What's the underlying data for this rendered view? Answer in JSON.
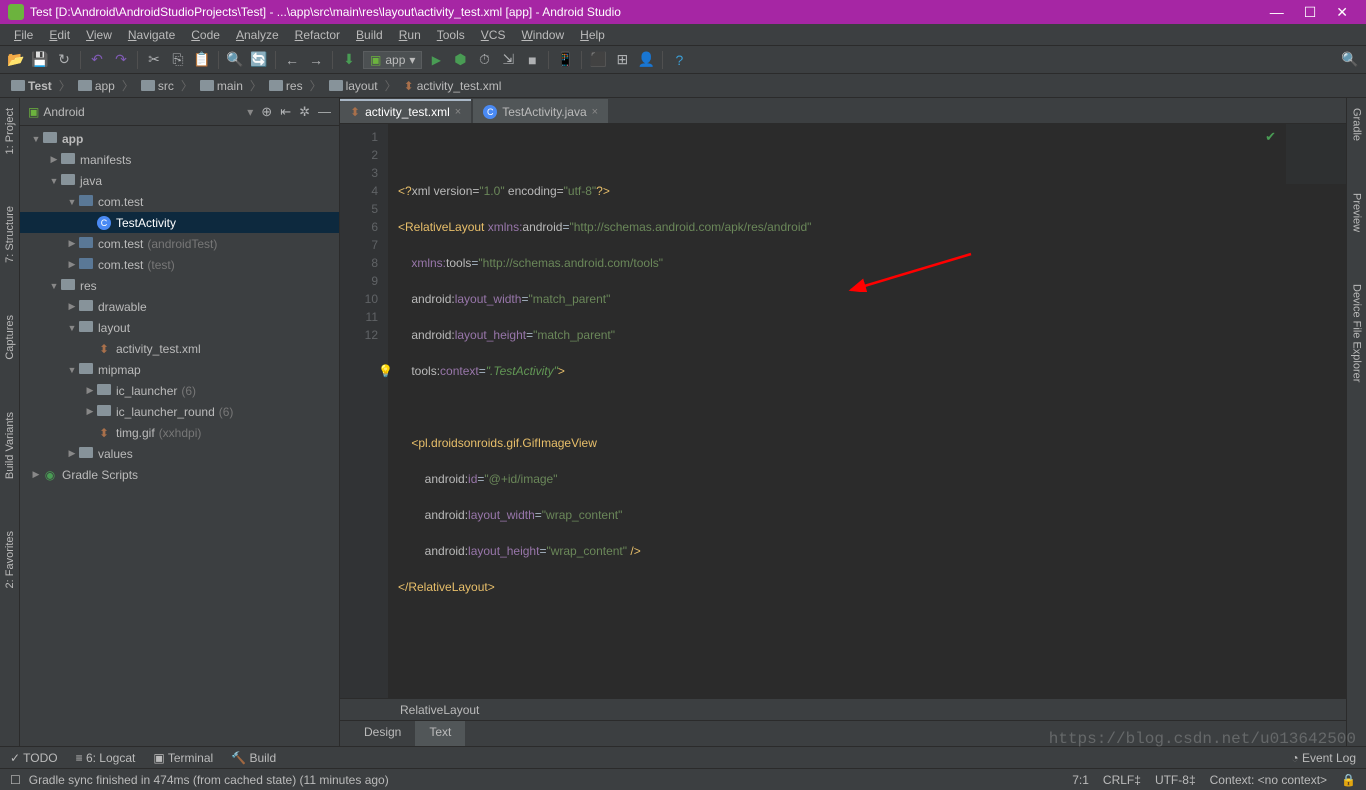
{
  "title": "Test [D:\\Android\\AndroidStudioProjects\\Test] - ...\\app\\src\\main\\res\\layout\\activity_test.xml [app] - Android Studio",
  "menu": [
    "File",
    "Edit",
    "View",
    "Navigate",
    "Code",
    "Analyze",
    "Refactor",
    "Build",
    "Run",
    "Tools",
    "VCS",
    "Window",
    "Help"
  ],
  "runConfig": "app",
  "breadcrumb": [
    "Test",
    "app",
    "src",
    "main",
    "res",
    "layout",
    "activity_test.xml"
  ],
  "sidebar": {
    "header": "Android"
  },
  "tree": [
    {
      "ind": 0,
      "arrow": "▼",
      "ico": "folder",
      "label": "app",
      "bold": true
    },
    {
      "ind": 1,
      "arrow": "▶",
      "ico": "folder",
      "label": "manifests"
    },
    {
      "ind": 1,
      "arrow": "▼",
      "ico": "folder",
      "label": "java"
    },
    {
      "ind": 2,
      "arrow": "▼",
      "ico": "package",
      "label": "com.test"
    },
    {
      "ind": 3,
      "arrow": "",
      "ico": "class",
      "label": "TestActivity",
      "sel": true
    },
    {
      "ind": 2,
      "arrow": "▶",
      "ico": "package",
      "label": "com.test",
      "dim": "(androidTest)"
    },
    {
      "ind": 2,
      "arrow": "▶",
      "ico": "package",
      "label": "com.test",
      "dim": "(test)"
    },
    {
      "ind": 1,
      "arrow": "▼",
      "ico": "folder",
      "label": "res"
    },
    {
      "ind": 2,
      "arrow": "▶",
      "ico": "folder",
      "label": "drawable"
    },
    {
      "ind": 2,
      "arrow": "▼",
      "ico": "folder",
      "label": "layout"
    },
    {
      "ind": 3,
      "arrow": "",
      "ico": "xml",
      "label": "activity_test.xml"
    },
    {
      "ind": 2,
      "arrow": "▼",
      "ico": "folder",
      "label": "mipmap"
    },
    {
      "ind": 3,
      "arrow": "▶",
      "ico": "folder",
      "label": "ic_launcher",
      "dim": "(6)"
    },
    {
      "ind": 3,
      "arrow": "▶",
      "ico": "folder",
      "label": "ic_launcher_round",
      "dim": "(6)"
    },
    {
      "ind": 3,
      "arrow": "",
      "ico": "xml",
      "label": "timg.gif",
      "dim": "(xxhdpi)"
    },
    {
      "ind": 2,
      "arrow": "▶",
      "ico": "folder",
      "label": "values"
    },
    {
      "ind": 0,
      "arrow": "▶",
      "ico": "gradle",
      "label": "Gradle Scripts"
    }
  ],
  "tabs": [
    {
      "label": "activity_test.xml",
      "ico": "xml",
      "active": true
    },
    {
      "label": "TestActivity.java",
      "ico": "class",
      "active": false
    }
  ],
  "lineCount": 12,
  "breadbar": "RelativeLayout",
  "dtTabs": {
    "design": "Design",
    "text": "Text"
  },
  "bottom": {
    "todo": "TODO",
    "logcat": "6: Logcat",
    "terminal": "Terminal",
    "build": "Build",
    "eventlog": "Event Log"
  },
  "status": {
    "msg": "Gradle sync finished in 474ms (from cached state) (11 minutes ago)",
    "pos": "7:1",
    "crlf": "CRLF",
    "enc": "UTF-8",
    "ctx": "Context: <no context>"
  },
  "leftTools": [
    "1: Project",
    "7: Structure",
    "Captures",
    "Build Variants",
    "2: Favorites"
  ],
  "rightTools": [
    "Gradle",
    "Preview",
    "Device File Explorer"
  ],
  "watermark": "https://blog.csdn.net/u013642500"
}
